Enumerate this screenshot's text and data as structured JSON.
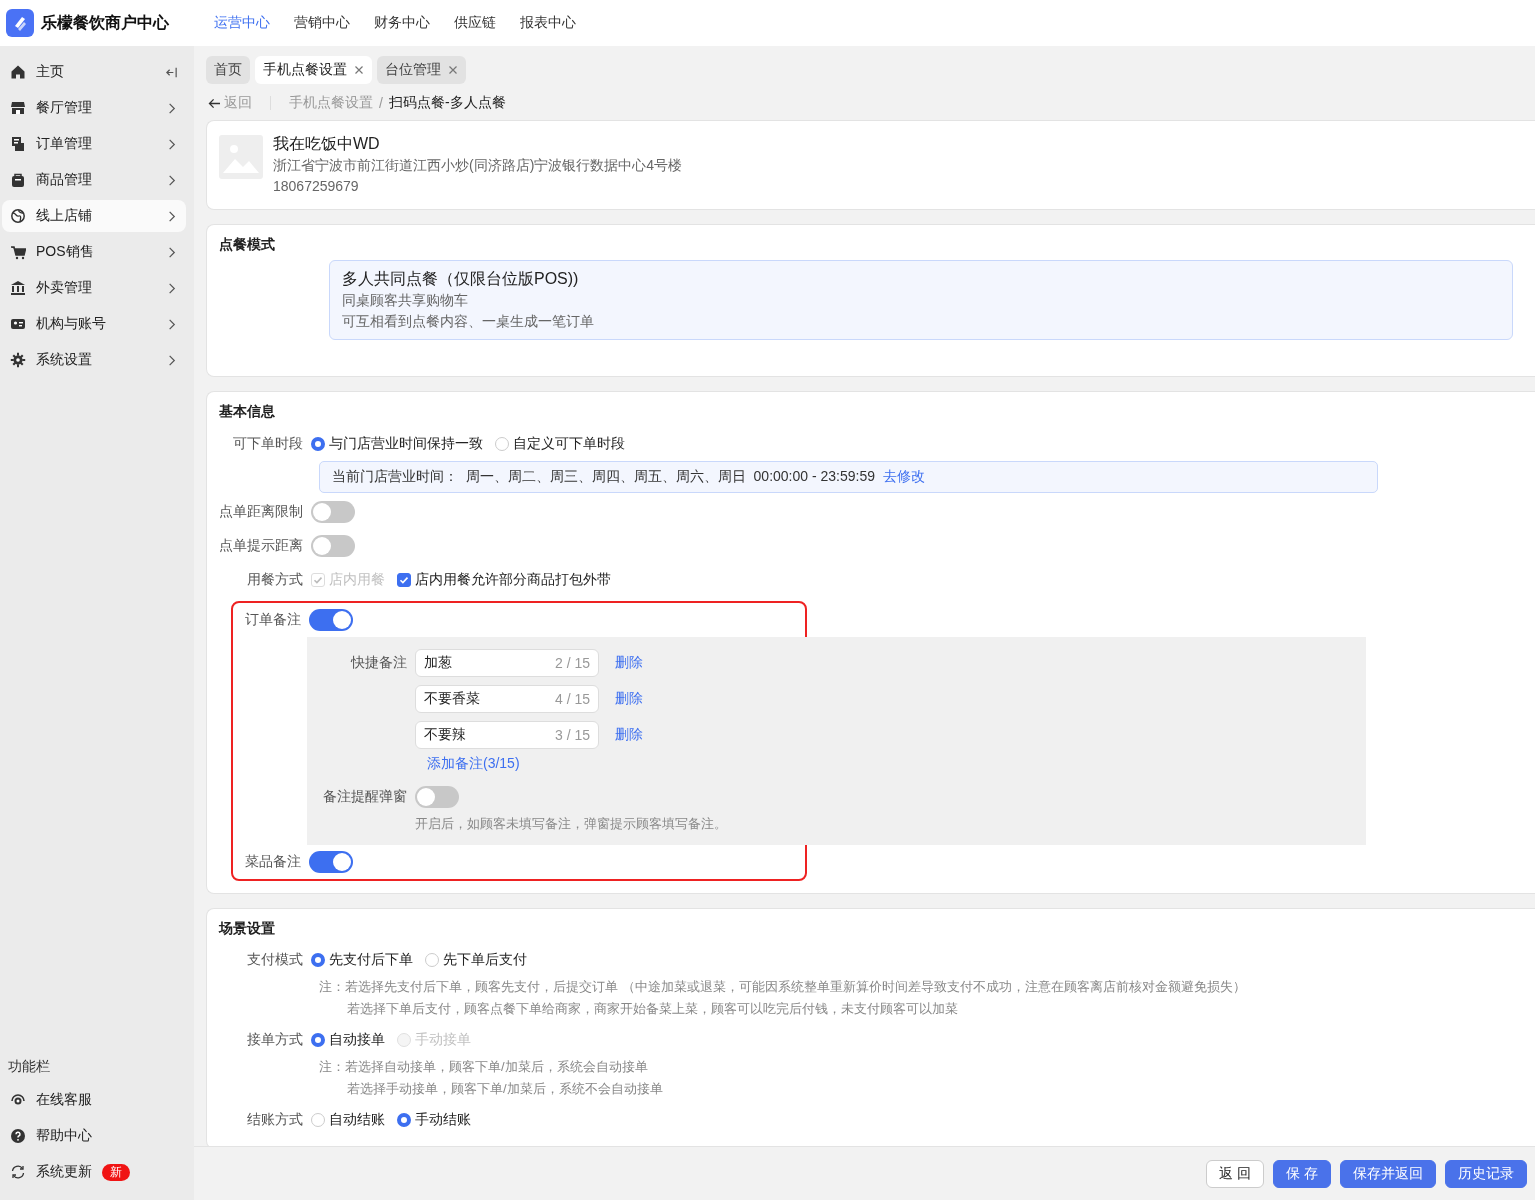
{
  "brand": {
    "name": "乐檬餐饮商户中心"
  },
  "top_nav": [
    {
      "label": "运营中心",
      "selected": true
    },
    {
      "label": "营销中心",
      "selected": false
    },
    {
      "label": "财务中心",
      "selected": false
    },
    {
      "label": "供应链",
      "selected": false
    },
    {
      "label": "报表中心",
      "selected": false
    }
  ],
  "sidebar": {
    "items": [
      {
        "label": "主页",
        "kind": "collapse",
        "selected": false
      },
      {
        "label": "餐厅管理",
        "kind": "chevron",
        "selected": false
      },
      {
        "label": "订单管理",
        "kind": "chevron",
        "selected": false
      },
      {
        "label": "商品管理",
        "kind": "chevron",
        "selected": false
      },
      {
        "label": "线上店铺",
        "kind": "chevron",
        "selected": true
      },
      {
        "label": "POS销售",
        "kind": "chevron",
        "selected": false
      },
      {
        "label": "外卖管理",
        "kind": "chevron",
        "selected": false
      },
      {
        "label": "机构与账号",
        "kind": "chevron",
        "selected": false
      },
      {
        "label": "系统设置",
        "kind": "chevron",
        "selected": false
      }
    ],
    "section_title": "功能栏",
    "tools": [
      {
        "label": "在线客服"
      },
      {
        "label": "帮助中心"
      },
      {
        "label": "系统更新",
        "badge": "新"
      }
    ]
  },
  "tabs": [
    {
      "label": "首页",
      "selected": false,
      "closable": false
    },
    {
      "label": "手机点餐设置",
      "selected": true,
      "closable": true
    },
    {
      "label": "台位管理",
      "selected": false,
      "closable": true
    }
  ],
  "breadcrumb": {
    "back": "返回",
    "separator": "/",
    "items": [
      "手机点餐设置",
      "扫码点餐-多人点餐"
    ]
  },
  "store": {
    "name": "我在吃饭中WD",
    "address": "浙江省宁波市前江街道江西小炒(同济路店)宁波银行数据中心4号楼",
    "phone": "18067259679"
  },
  "order_mode": {
    "title": "点餐模式",
    "option": {
      "title": "多人共同点餐（仅限台位版POS))",
      "lines": [
        "同桌顾客共享购物车",
        "可互相看到点餐内容、一桌生成一笔订单"
      ],
      "selected": true
    }
  },
  "basic": {
    "title": "基本信息",
    "rows": [
      {
        "kind": "radio",
        "label": "可下单时段",
        "options": [
          {
            "label": "与门店营业时间保持一致",
            "selected": true,
            "disabled": false
          },
          {
            "label": "自定义可下单时段",
            "selected": false,
            "disabled": false
          }
        ],
        "info": {
          "text": "当前门店营业时间：  周一、周二、周三、周四、周五、周六、周日  00:00:00 - 23:59:59",
          "link": "去修改"
        }
      },
      {
        "kind": "toggle",
        "label": "点单距离限制",
        "on": false
      },
      {
        "kind": "toggle",
        "label": "点单提示距离",
        "on": false
      },
      {
        "kind": "checkbox",
        "label": "用餐方式",
        "options": [
          {
            "label": "店内用餐",
            "checked": true,
            "disabled": true
          },
          {
            "label": "店内用餐允许部分商品打包外带",
            "checked": true,
            "disabled": false
          }
        ]
      }
    ],
    "remarks": {
      "highlighted": true,
      "order_remark": {
        "label": "订单备注",
        "on": true,
        "panel": {
          "quick_label": "快捷备注",
          "notes": [
            {
              "value": "加葱",
              "count": "2 / 15",
              "delete": "删除"
            },
            {
              "value": "不要香菜",
              "count": "4 / 15",
              "delete": "删除"
            },
            {
              "value": "不要辣",
              "count": "3 / 15",
              "delete": "删除"
            }
          ],
          "add_link": "添加备注(3/15)",
          "popup": {
            "label": "备注提醒弹窗",
            "on": false,
            "hint": "开启后，如顾客未填写备注，弹窗提示顾客填写备注。"
          }
        }
      },
      "dish_remark": {
        "label": "菜品备注",
        "on": true
      }
    }
  },
  "scene": {
    "title": "场景设置",
    "rows": [
      {
        "label": "支付模式",
        "options": [
          {
            "label": "先支付后下单",
            "selected": true,
            "disabled": false
          },
          {
            "label": "先下单后支付",
            "selected": false,
            "disabled": false
          }
        ],
        "notes": [
          "注：若选择先支付后下单，顾客先支付，后提交订单 （中途加菜或退菜，可能因系统整单重新算价时间差导致支付不成功，注意在顾客离店前核对金额避免损失）",
          "若选择下单后支付，顾客点餐下单给商家，商家开始备菜上菜，顾客可以吃完后付钱，未支付顾客可以加菜"
        ]
      },
      {
        "label": "接单方式",
        "options": [
          {
            "label": "自动接单",
            "selected": true,
            "disabled": false
          },
          {
            "label": "手动接单",
            "selected": false,
            "disabled": true
          }
        ],
        "notes": [
          "注：若选择自动接单，顾客下单/加菜后，系统会自动接单",
          "若选择手动接单，顾客下单/加菜后，系统不会自动接单"
        ]
      },
      {
        "label": "结账方式",
        "options": [
          {
            "label": "自动结账",
            "selected": false,
            "disabled": false
          },
          {
            "label": "手动结账",
            "selected": true,
            "disabled": false
          }
        ]
      }
    ]
  },
  "footer": {
    "buttons": [
      {
        "label": "返 回",
        "kind": "default"
      },
      {
        "label": "保 存",
        "kind": "primary"
      },
      {
        "label": "保存并返回",
        "kind": "primary"
      },
      {
        "label": "历史记录",
        "kind": "primary"
      }
    ]
  }
}
